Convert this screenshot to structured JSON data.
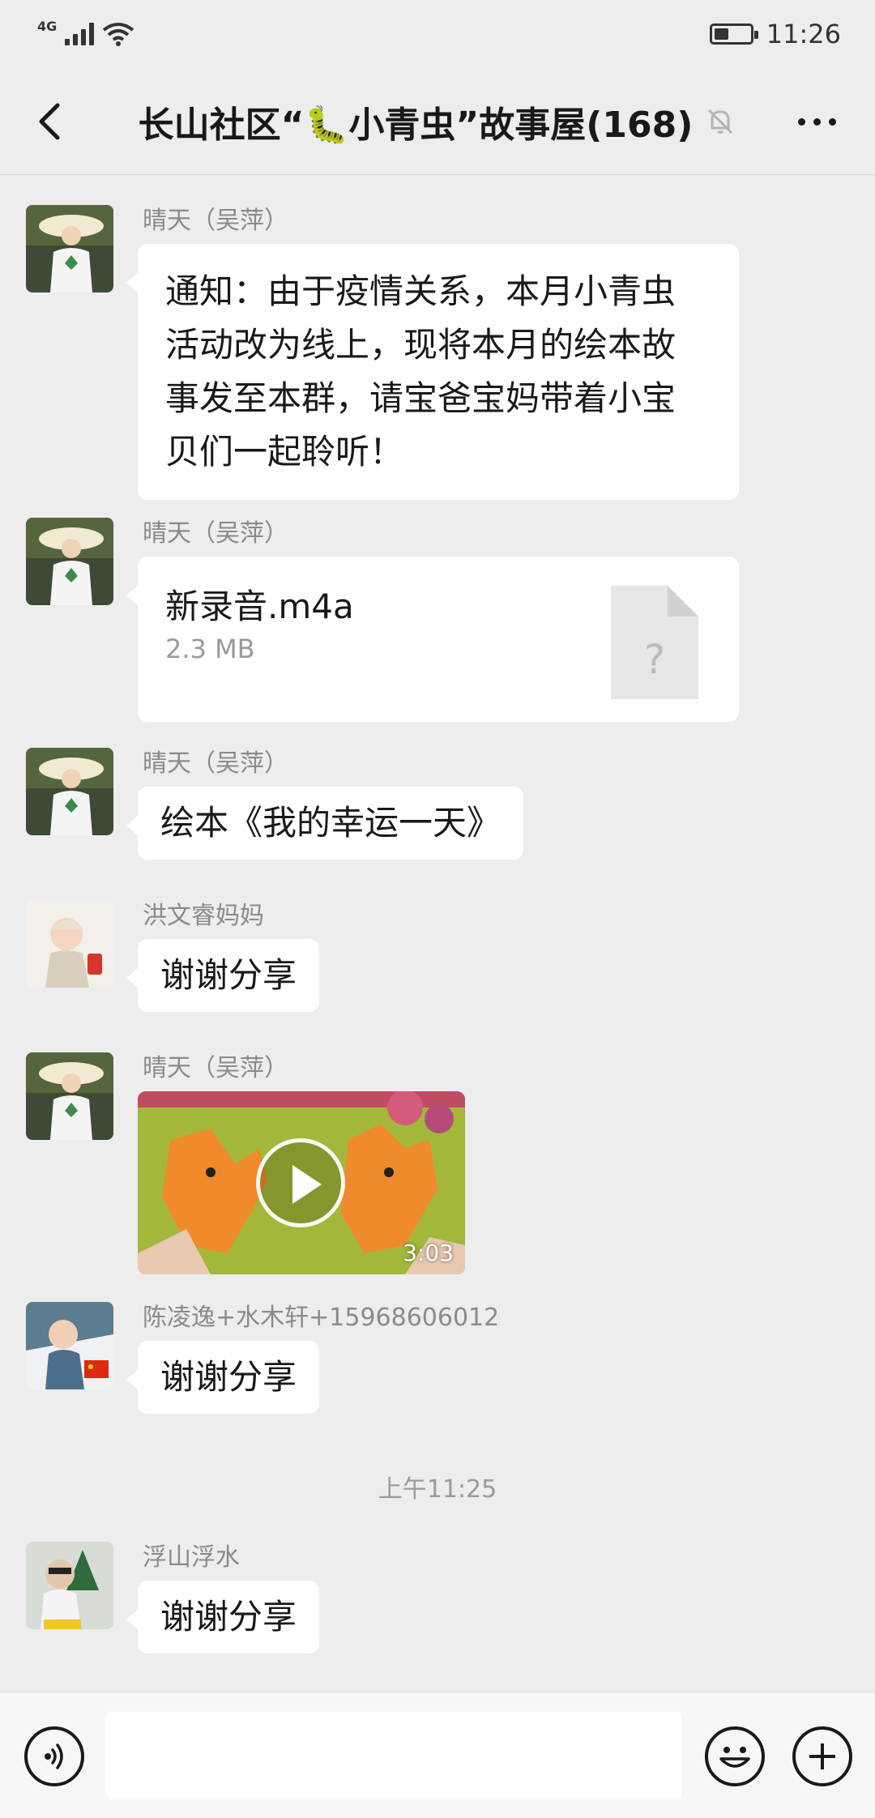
{
  "status_bar": {
    "network": "4G",
    "time": "11:26",
    "battery_level": 0.4
  },
  "header": {
    "title": "长山社区“🐛小青虫”故事屋(168)",
    "back_icon": "chevron-left-icon",
    "mute_icon": "bell-off-icon",
    "more_icon": "more-dots-icon"
  },
  "messages": [
    {
      "sender": "晴天（吴萍）",
      "type": "text",
      "lines": [
        "通知：由于疫情关系，本月小青虫",
        "活动改为线上，现将本月的绘本故",
        "事发至本群，请宝爸宝妈带着小宝",
        "贝们一起聆听！"
      ]
    },
    {
      "sender": "晴天（吴萍）",
      "type": "file",
      "file_name": "新录音.m4a",
      "file_size": "2.3 MB",
      "file_icon": "unknown-file-icon",
      "file_icon_glyph": "?"
    },
    {
      "sender": "晴天（吴萍）",
      "type": "text",
      "text": "绘本《我的幸运一天》"
    },
    {
      "sender": "洪文睿妈妈",
      "type": "text",
      "text": "谢谢分享"
    },
    {
      "sender": "晴天（吴萍）",
      "type": "video",
      "duration": "3:03",
      "play_icon": "play-icon"
    },
    {
      "sender": "陈凌逸+水木轩+15968606012",
      "type": "text",
      "text": "谢谢分享"
    },
    {
      "sender": "浮山浮水",
      "type": "text",
      "text": "谢谢分享"
    }
  ],
  "timestamp": "上午11:25",
  "input_bar": {
    "voice_icon": "voice-icon",
    "emoji_icon": "emoji-icon",
    "plus_icon": "plus-icon",
    "placeholder": ""
  },
  "colors": {
    "background": "#ededed",
    "bubble": "#ffffff",
    "sender_text": "#8a8a8a",
    "video_bg": "#a9bf3a"
  }
}
